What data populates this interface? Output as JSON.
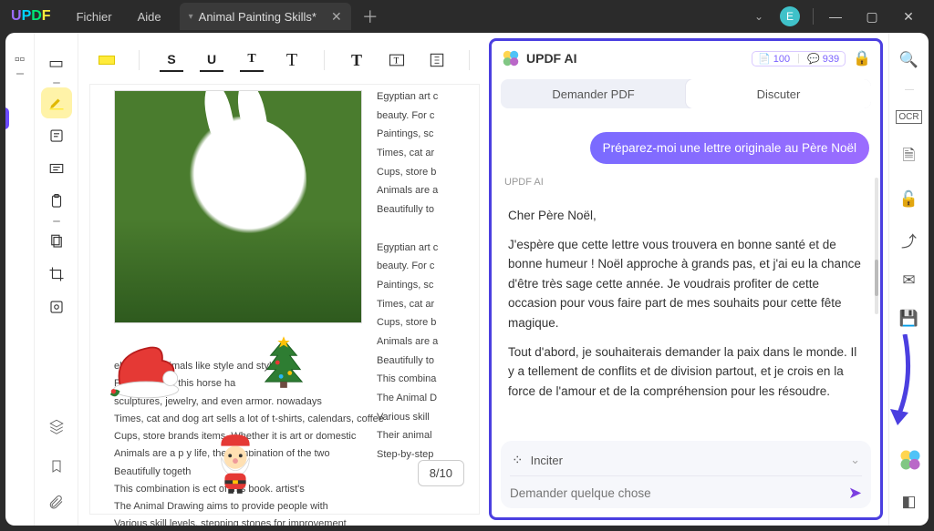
{
  "titlebar": {
    "menu": {
      "file": "Fichier",
      "help": "Aide"
    },
    "tab_title": "Animal Painting Skills*",
    "avatar_initial": "E"
  },
  "tools": {
    "highlighter": "highlighter",
    "page_counter": "8/10"
  },
  "document": {
    "lines1": [
      "Egyptian art c",
      "beauty. For c",
      "Paintings, sc",
      "Times, cat ar",
      "Cups, store b",
      "Animals are a",
      "Beautifully to",
      "",
      "Egyptian art c",
      "beauty. For c",
      "Paintings, sc",
      "Times, cat ar",
      "Cups, store b",
      "Animals are a",
      "Beautifully to",
      "This combina",
      "The Animal D",
      "Various skill",
      "Their animal",
      "Step-by-step"
    ],
    "para2": [
      "elebrates animals like            style and style",
      "For centuries, this horse ha",
      "sculptures, jewelry, and even armor. nowadays",
      "Times, cat and dog art sells a lot of t-shirts, calendars, coffee",
      "Cups, store brands            items. Whether it is art or domestic",
      "Animals are a p                    y life, the combination of the two",
      "Beautifully togeth",
      "This combination is               ect of this book. artist's",
      "The Animal Drawing            aims to provide people with",
      "Various skill levels, stepping stones for improvement"
    ]
  },
  "ai": {
    "title": "UPDF AI",
    "credits_a": "100",
    "credits_b": "939",
    "tab_ask": "Demander PDF",
    "tab_chat": "Discuter",
    "user_msg": "Préparez-moi une lettre originale au Père Noël",
    "sender_label": "UPDF AI",
    "reply_p1": "Cher Père Noël,",
    "reply_p2": "J'espère que cette lettre vous trouvera en bonne santé et de bonne humeur ! Noël approche à grands pas, et j'ai eu la chance d'être très sage cette année. Je voudrais profiter de cette occasion pour vous faire part de mes souhaits pour cette fête magique.",
    "reply_p3": "Tout d'abord, je souhaiterais demander la paix dans le monde. Il y a tellement de conflits et de division partout, et je crois en la force de l'amour et de la compréhension pour les résoudre.",
    "inciter": "Inciter",
    "placeholder": "Demander quelque chose"
  }
}
